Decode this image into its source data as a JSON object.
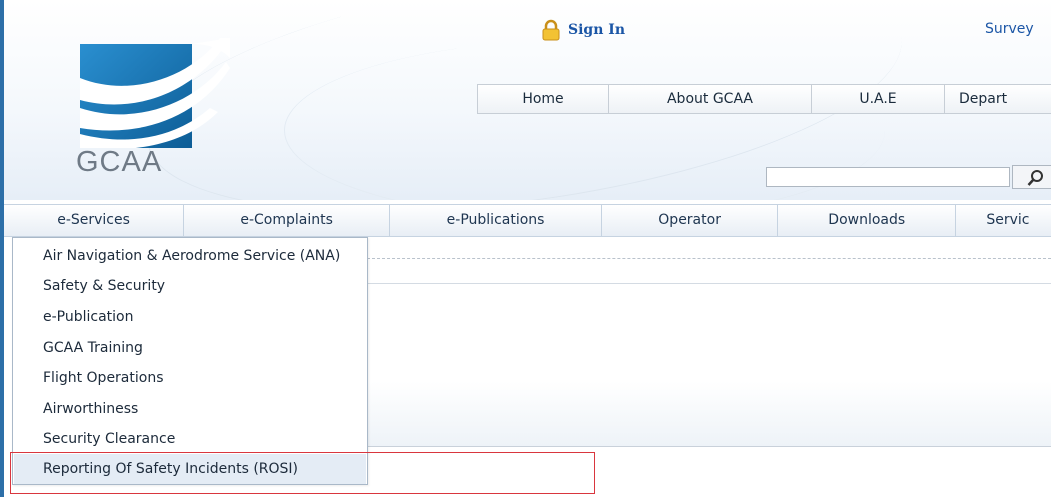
{
  "header": {
    "logo_text": "GCAA",
    "sign_in": "Sign In",
    "survey": "Survey",
    "nav": [
      "Home",
      "About GCAA",
      "U.A.E",
      "Depart"
    ],
    "search": {
      "value": "",
      "placeholder": ""
    },
    "icons": [
      "lock-icon",
      "search-icon"
    ]
  },
  "main_nav": {
    "tabs": [
      "e-Services",
      "e-Complaints",
      "e-Publications",
      "Operator",
      "Downloads",
      "Servic"
    ]
  },
  "dropdown": {
    "items": [
      "Air Navigation & Aerodrome Service (ANA)",
      "Safety & Security",
      "e-Publication",
      "GCAA Training",
      "Flight Operations",
      "Airworthiness",
      "Security Clearance",
      "Reporting Of Safety Incidents (ROSI)"
    ],
    "highlighted_index": 7
  },
  "colors": {
    "brand_blue": "#1b56a6",
    "logo_blue": "#1a7fc0",
    "highlight_red": "#d9363e"
  }
}
